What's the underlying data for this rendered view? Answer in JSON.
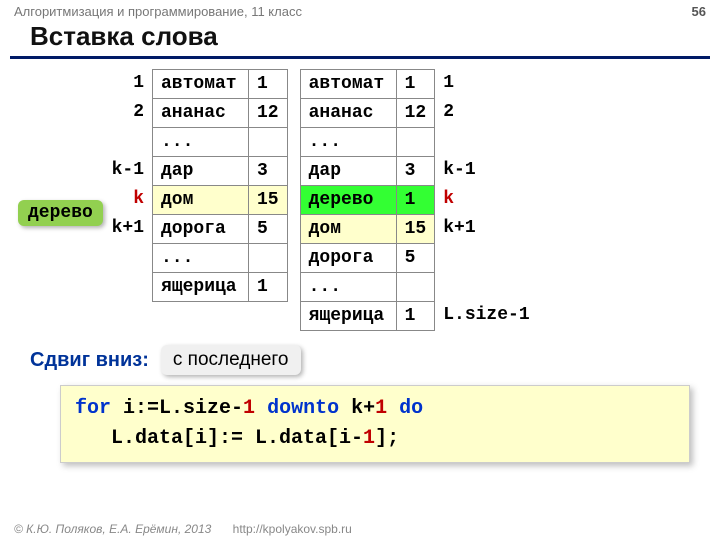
{
  "header": {
    "course": "Алгоритмизация и программирование, 11 класс",
    "page": "56"
  },
  "title": "Вставка слова",
  "tag_word": "дерево",
  "left_idx": [
    "1",
    "2",
    "",
    "k-1",
    "k",
    "k+1",
    "",
    ""
  ],
  "right_idx": [
    "1",
    "2",
    "",
    "k-1",
    "k",
    "k+1",
    "",
    "",
    "L.size-1"
  ],
  "tableA": [
    {
      "w": "автомат",
      "n": "1",
      "y": 0
    },
    {
      "w": "ананас",
      "n": "12",
      "y": 0
    },
    {
      "w": "...",
      "n": "",
      "y": 0
    },
    {
      "w": "дар",
      "n": "3",
      "y": 0
    },
    {
      "w": "дом",
      "n": "15",
      "y": 1
    },
    {
      "w": "дорога",
      "n": "5",
      "y": 0
    },
    {
      "w": "...",
      "n": "",
      "y": 0
    },
    {
      "w": "ящерица",
      "n": "1",
      "y": 0
    }
  ],
  "tableB": [
    {
      "w": "автомат",
      "n": "1",
      "y": 0,
      "g": 0
    },
    {
      "w": "ананас",
      "n": "12",
      "y": 0,
      "g": 0
    },
    {
      "w": "...",
      "n": "",
      "y": 0,
      "g": 0
    },
    {
      "w": "дар",
      "n": "3",
      "y": 0,
      "g": 0
    },
    {
      "w": "дерево",
      "n": "1",
      "y": 0,
      "g": 1
    },
    {
      "w": "дом",
      "n": "15",
      "y": 1,
      "g": 0
    },
    {
      "w": "дорога",
      "n": "5",
      "y": 0,
      "g": 0
    },
    {
      "w": "...",
      "n": "",
      "y": 0,
      "g": 0
    },
    {
      "w": "ящерица",
      "n": "1",
      "y": 0,
      "g": 0
    }
  ],
  "shift": {
    "label": "Сдвиг вниз:",
    "callout": "с последнего"
  },
  "code": {
    "t1": "for",
    "t2": " i:=L.size-",
    "t3": "1",
    "t4": " downto",
    "t5": " k+",
    "t6": "1",
    "t7": " do",
    "t8": "   L.data[i]:= L.data[i-",
    "t9": "1",
    "t10": "];"
  },
  "footer": {
    "copy": "© К.Ю. Поляков, Е.А. Ерёмин, 2013",
    "url": "http://kpolyakov.spb.ru"
  }
}
